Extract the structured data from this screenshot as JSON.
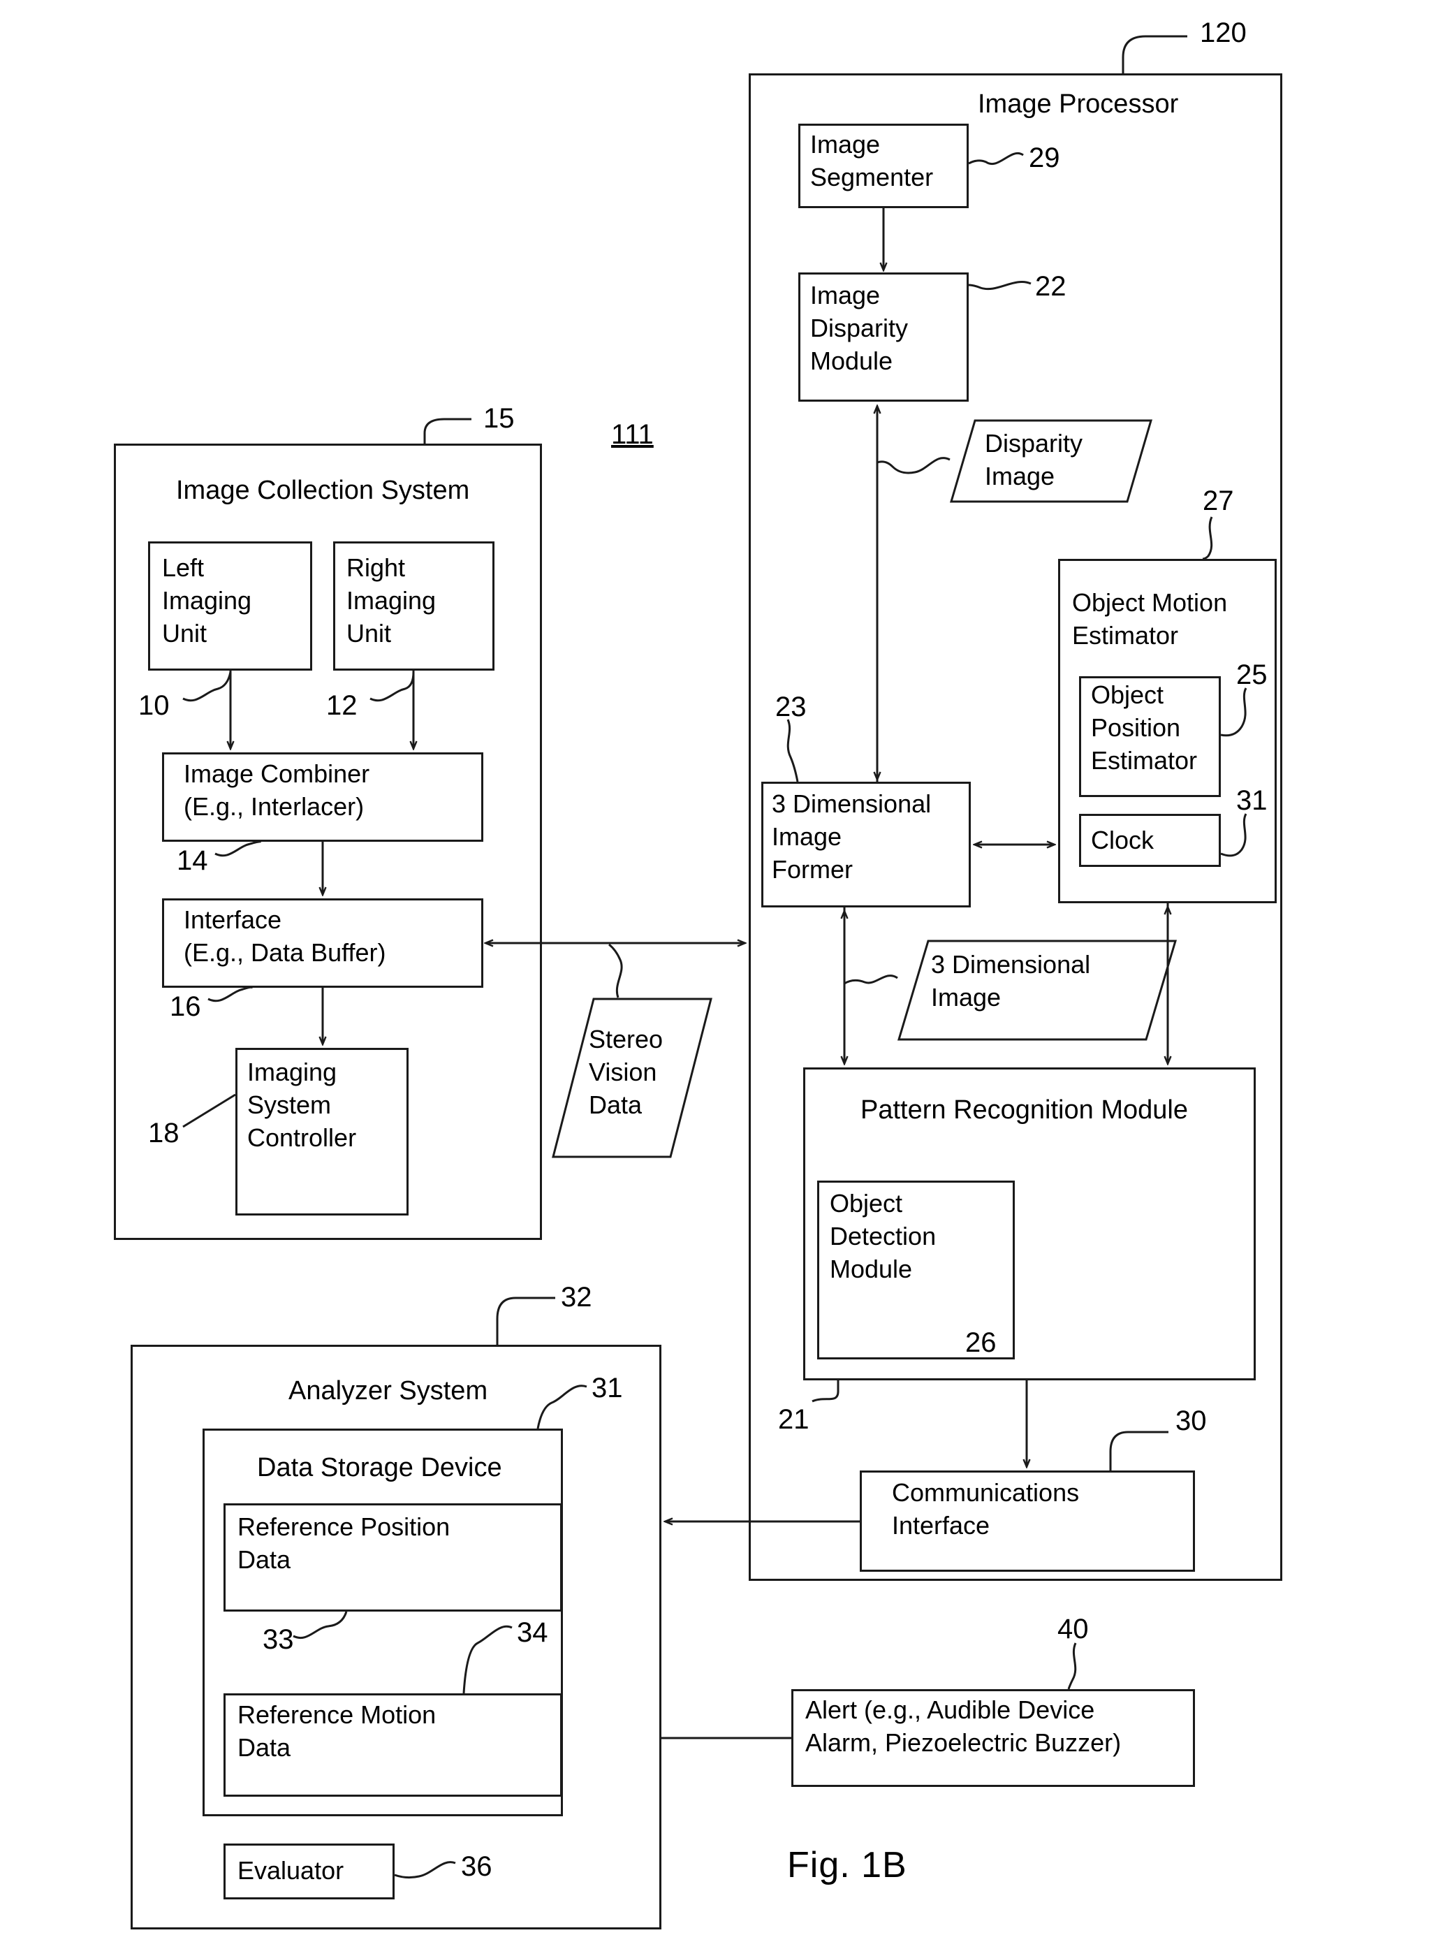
{
  "figure": {
    "caption": "Fig. 1B",
    "system_ref": "111"
  },
  "image_collection_system": {
    "title": "Image Collection System",
    "ref": "15",
    "left_imaging_unit": {
      "label": "Left\nImaging\nUnit",
      "ref": "10"
    },
    "right_imaging_unit": {
      "label": "Right\nImaging\nUnit",
      "ref": "12"
    },
    "image_combiner": {
      "label": "Image Combiner\n(E.g., Interlacer)",
      "ref": "14"
    },
    "interface": {
      "label": "Interface\n(E.g., Data Buffer)",
      "ref": "16"
    },
    "imaging_system_controller": {
      "label": "Imaging\nSystem\nController",
      "ref": "18"
    }
  },
  "stereo_vision_data": {
    "label": "Stereo\nVision\nData"
  },
  "image_processor": {
    "title": "Image Processor",
    "ref": "120",
    "image_segmenter": {
      "label": "Image\nSegmenter",
      "ref": "29"
    },
    "image_disparity_module": {
      "label": "Image\nDisparity\nModule",
      "ref": "22"
    },
    "disparity_image": {
      "label": "Disparity\nImage"
    },
    "object_motion_estimator": {
      "label": "Object Motion\nEstimator",
      "ref": "27",
      "object_position_estimator": {
        "label": "Object\nPosition\nEstimator",
        "ref": "25"
      },
      "clock": {
        "label": "Clock",
        "ref": "31"
      }
    },
    "three_d_image_former": {
      "label": "3 Dimensional\nImage\nFormer",
      "ref": "23"
    },
    "three_d_image": {
      "label": "3 Dimensional\nImage"
    },
    "pattern_recognition_module": {
      "label": "Pattern Recognition Module",
      "ref": "21",
      "object_detection_module": {
        "label": "Object\nDetection\nModule",
        "ref": "26"
      }
    },
    "communications_interface": {
      "label": "Communications\nInterface",
      "ref": "30"
    }
  },
  "analyzer_system": {
    "title": "Analyzer System",
    "ref": "32",
    "data_storage_device": {
      "label": "Data Storage Device",
      "ref": "31",
      "reference_position_data": {
        "label": "Reference Position\nData",
        "ref": "33"
      },
      "reference_motion_data": {
        "label": "Reference Motion\nData",
        "ref": "34"
      }
    },
    "evaluator": {
      "label": "Evaluator",
      "ref": "36"
    }
  },
  "alert": {
    "label": "Alert (e.g., Audible Device\nAlarm, Piezoelectric Buzzer)",
    "ref": "40"
  }
}
